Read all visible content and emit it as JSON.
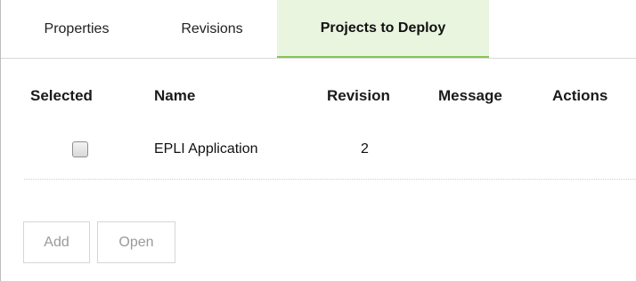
{
  "tabs": [
    {
      "label": "Properties",
      "active": false
    },
    {
      "label": "Revisions",
      "active": false
    },
    {
      "label": "Projects to Deploy",
      "active": true
    }
  ],
  "table": {
    "columns": [
      "Selected",
      "Name",
      "Revision",
      "Message",
      "Actions"
    ],
    "rows": [
      {
        "selected": false,
        "name": "EPLI Application",
        "revision": "2",
        "message": "",
        "actions": ""
      }
    ]
  },
  "buttons": {
    "add_label": "Add",
    "open_label": "Open"
  },
  "colors": {
    "active_tab_bg": "#e9f5df",
    "active_tab_accent": "#86c45a",
    "disabled_text": "#9a9a9a"
  }
}
